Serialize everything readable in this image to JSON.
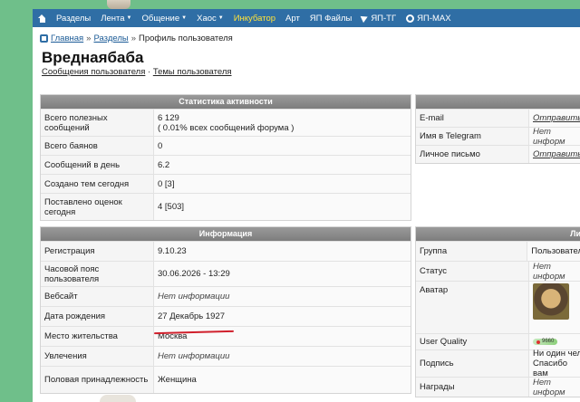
{
  "nav": {
    "items": [
      {
        "label": "Разделы",
        "caret": false
      },
      {
        "label": "Лента",
        "caret": true
      },
      {
        "label": "Общение",
        "caret": true
      },
      {
        "label": "Хаос",
        "caret": true
      },
      {
        "label": "Инкубатор",
        "caret": false,
        "highlight": "#ffe23a"
      },
      {
        "label": "Арт",
        "caret": false
      },
      {
        "label": "ЯП Файлы",
        "caret": false
      }
    ],
    "tg_label": "ЯП-ТГ",
    "max_label": "ЯП-MAX"
  },
  "breadcrumb": {
    "home": "Главная",
    "sep1": "»",
    "sections": "Разделы",
    "sep2": "»",
    "current": "Профиль пользователя"
  },
  "profile": {
    "username": "Вреднаябаба",
    "link_messages": "Сообщения пользователя",
    "link_sep": "·",
    "link_topics": "Темы пользователя"
  },
  "stats": {
    "header": "Статистика активности",
    "rows": [
      {
        "k": "Всего полезных сообщений",
        "v": "6 129",
        "v2": "( 0.01% всех сообщений форума )"
      },
      {
        "k": "Всего баянов",
        "v": "0"
      },
      {
        "k": "Сообщений в день",
        "v": "6.2"
      },
      {
        "k": "Создано тем сегодня",
        "v": "0 [3]"
      },
      {
        "k": "Поставлено оценок сегодня",
        "v": "4 [503]"
      }
    ]
  },
  "contacts": {
    "rows": [
      {
        "k": "E-mail",
        "v": "Отправить"
      },
      {
        "k": "Имя в Telegram",
        "v": "Нет информ"
      },
      {
        "k": "Личное письмо",
        "v": "Отправить"
      }
    ]
  },
  "info": {
    "header": "Информация",
    "rows": [
      {
        "k": "Регистрация",
        "v": "9.10.23"
      },
      {
        "k": "Часовой пояс пользователя",
        "v": "30.06.2026 - 13:29"
      },
      {
        "k": "Вебсайт",
        "v": "Нет информации"
      },
      {
        "k": "Дата рождения",
        "v": "27 Декабрь 1927"
      },
      {
        "k": "Место жительства",
        "v": "Москва"
      },
      {
        "k": "Увлечения",
        "v": "Нет информации"
      },
      {
        "k": "Половая принадлежность",
        "v": "Женщина"
      }
    ]
  },
  "personal": {
    "header": "Ли",
    "group_k": "Группа",
    "group_v": "Пользовател",
    "status_k": "Статус",
    "status_v": "Нет информ",
    "avatar_k": "Аватар",
    "quality_k": "User Quality",
    "quality_v": "9660",
    "sign_k": "Подпись",
    "sign_v1": "Ни один чел",
    "sign_v2": "Спасибо вам",
    "awards_k": "Награды",
    "awards_v": "Нет информ"
  },
  "colors": {
    "nav": "#2f6ea5",
    "panel_header": "#8a8a8a",
    "annotation": "#d0202c"
  }
}
